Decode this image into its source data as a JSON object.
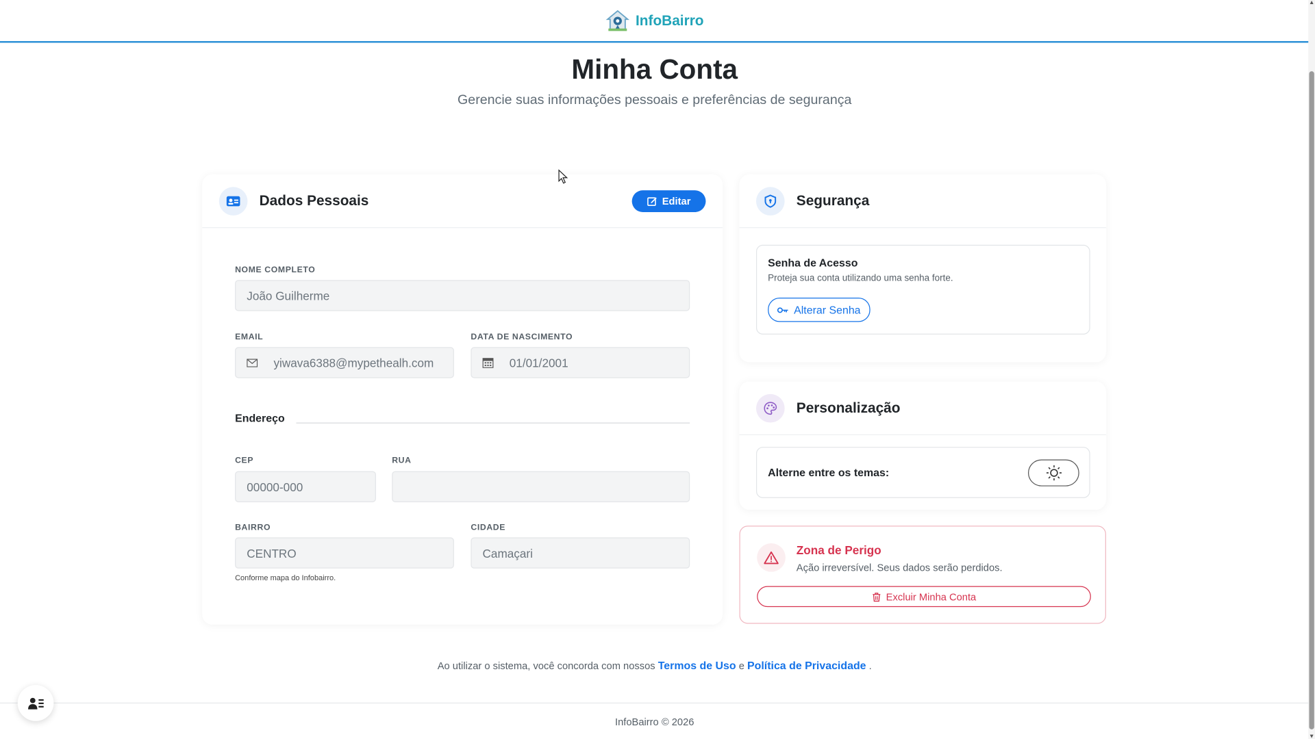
{
  "brand": {
    "name": "InfoBairro"
  },
  "page": {
    "title": "Minha Conta",
    "subtitle": "Gerencie suas informações pessoais e preferências de segurança"
  },
  "personal": {
    "title": "Dados Pessoais",
    "edit_label": "Editar",
    "name_label": "NOME COMPLETO",
    "name_value": "João Guilherme",
    "email_label": "EMAIL",
    "email_value": "yiwava6388@mypethealh.com",
    "birth_label": "DATA DE NASCIMENTO",
    "birth_value": "01/01/2001",
    "address_title": "Endereço",
    "cep_label": "CEP",
    "cep_placeholder": "00000-000",
    "street_label": "RUA",
    "street_value": "",
    "neighborhood_label": "BAIRRO",
    "neighborhood_value": "CENTRO",
    "neighborhood_hint": "Conforme mapa do Infobairro.",
    "city_label": "CIDADE",
    "city_value": "Camaçari"
  },
  "security": {
    "title": "Segurança",
    "password_title": "Senha de Acesso",
    "password_desc": "Proteja sua conta utilizando uma senha forte.",
    "change_password_label": "Alterar Senha"
  },
  "personalization": {
    "title": "Personalização",
    "theme_label": "Alterne entre os temas:"
  },
  "danger": {
    "title": "Zona de Perigo",
    "desc": "Ação irreversível. Seus dados serão perdidos.",
    "delete_label": "Excluir Minha Conta"
  },
  "footer": {
    "consent_text": "Ao utilizar o sistema, você concorda com nossos",
    "terms_label": "Termos de Uso",
    "and_text": "e",
    "privacy_label": "Política de Privacidade",
    "period": ".",
    "copyright": "InfoBairro © 2026"
  },
  "colors": {
    "primary": "#1573e8",
    "brand": "#20a3b8",
    "danger": "#d6334f"
  },
  "icons": {
    "brand": "map-pin-house-icon",
    "personal": "id-card-icon",
    "edit": "pencil-square-icon",
    "email": "envelope-icon",
    "birth": "calendar-icon",
    "security": "shield-icon",
    "key": "key-icon",
    "personalization": "palette-icon",
    "theme": "sun-icon",
    "danger": "warning-triangle-icon",
    "trash": "trash-icon",
    "fab": "user-list-icon"
  }
}
